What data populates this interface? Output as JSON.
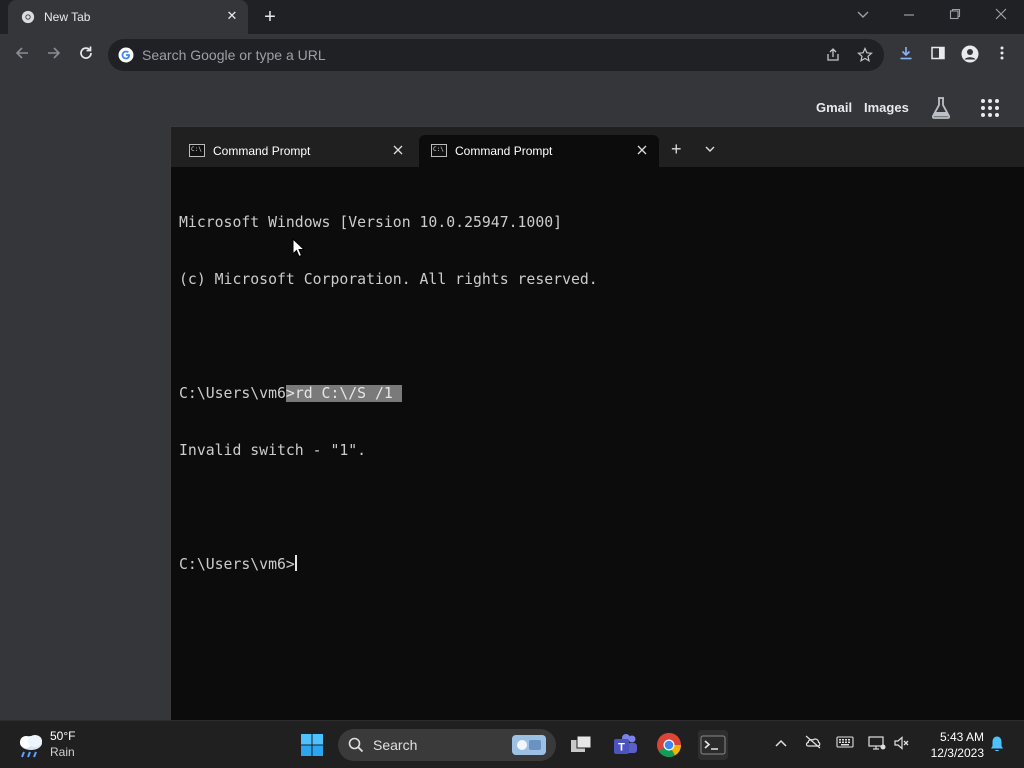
{
  "browser": {
    "tab": {
      "title": "New Tab",
      "close": "✕"
    },
    "new_tab": "+",
    "window_controls": [
      "chevron-down",
      "minimize",
      "restore",
      "close"
    ],
    "omnibox": {
      "placeholder": "Search Google or type a URL"
    },
    "toolbar_icons": [
      "share-icon",
      "star-icon",
      "download-icon",
      "side-panel-icon",
      "profile-icon",
      "menu-icon"
    ]
  },
  "ntp": {
    "gmail": "Gmail",
    "images": "Images"
  },
  "terminal": {
    "tabs": [
      {
        "title": "Command Prompt",
        "active": false
      },
      {
        "title": "Command Prompt",
        "active": true
      }
    ],
    "add": "+",
    "lines": {
      "l1": "Microsoft Windows [Version 10.0.25947.1000]",
      "l2": "(c) Microsoft Corporation. All rights reserved.",
      "l3_prompt": "C:\\Users\\vm6",
      "l3_selected": ">rd C:\\/S /1 ",
      "l4": "Invalid switch - \"1\".",
      "l5_prompt": "C:\\Users\\vm6>"
    }
  },
  "taskbar": {
    "weather": {
      "temp": "50°F",
      "desc": "Rain"
    },
    "search": {
      "label": "Search"
    },
    "clock": {
      "time": "5:43 AM",
      "date": "12/3/2023"
    }
  },
  "colors": {
    "accent": "#4cc2ff",
    "terminal_bg": "#0c0c0c",
    "browser_bg": "#35363a"
  }
}
